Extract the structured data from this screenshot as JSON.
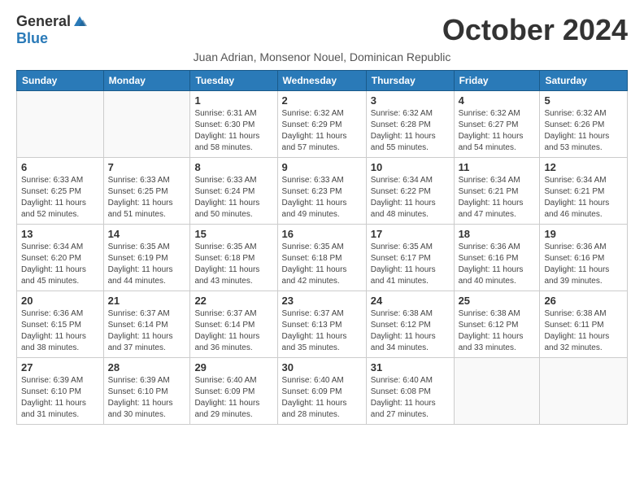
{
  "logo": {
    "general": "General",
    "blue": "Blue"
  },
  "title": "October 2024",
  "subtitle": "Juan Adrian, Monsenor Nouel, Dominican Republic",
  "headers": [
    "Sunday",
    "Monday",
    "Tuesday",
    "Wednesday",
    "Thursday",
    "Friday",
    "Saturday"
  ],
  "weeks": [
    [
      {
        "day": "",
        "info": ""
      },
      {
        "day": "",
        "info": ""
      },
      {
        "day": "1",
        "info": "Sunrise: 6:31 AM\nSunset: 6:30 PM\nDaylight: 11 hours and 58 minutes."
      },
      {
        "day": "2",
        "info": "Sunrise: 6:32 AM\nSunset: 6:29 PM\nDaylight: 11 hours and 57 minutes."
      },
      {
        "day": "3",
        "info": "Sunrise: 6:32 AM\nSunset: 6:28 PM\nDaylight: 11 hours and 55 minutes."
      },
      {
        "day": "4",
        "info": "Sunrise: 6:32 AM\nSunset: 6:27 PM\nDaylight: 11 hours and 54 minutes."
      },
      {
        "day": "5",
        "info": "Sunrise: 6:32 AM\nSunset: 6:26 PM\nDaylight: 11 hours and 53 minutes."
      }
    ],
    [
      {
        "day": "6",
        "info": "Sunrise: 6:33 AM\nSunset: 6:25 PM\nDaylight: 11 hours and 52 minutes."
      },
      {
        "day": "7",
        "info": "Sunrise: 6:33 AM\nSunset: 6:25 PM\nDaylight: 11 hours and 51 minutes."
      },
      {
        "day": "8",
        "info": "Sunrise: 6:33 AM\nSunset: 6:24 PM\nDaylight: 11 hours and 50 minutes."
      },
      {
        "day": "9",
        "info": "Sunrise: 6:33 AM\nSunset: 6:23 PM\nDaylight: 11 hours and 49 minutes."
      },
      {
        "day": "10",
        "info": "Sunrise: 6:34 AM\nSunset: 6:22 PM\nDaylight: 11 hours and 48 minutes."
      },
      {
        "day": "11",
        "info": "Sunrise: 6:34 AM\nSunset: 6:21 PM\nDaylight: 11 hours and 47 minutes."
      },
      {
        "day": "12",
        "info": "Sunrise: 6:34 AM\nSunset: 6:21 PM\nDaylight: 11 hours and 46 minutes."
      }
    ],
    [
      {
        "day": "13",
        "info": "Sunrise: 6:34 AM\nSunset: 6:20 PM\nDaylight: 11 hours and 45 minutes."
      },
      {
        "day": "14",
        "info": "Sunrise: 6:35 AM\nSunset: 6:19 PM\nDaylight: 11 hours and 44 minutes."
      },
      {
        "day": "15",
        "info": "Sunrise: 6:35 AM\nSunset: 6:18 PM\nDaylight: 11 hours and 43 minutes."
      },
      {
        "day": "16",
        "info": "Sunrise: 6:35 AM\nSunset: 6:18 PM\nDaylight: 11 hours and 42 minutes."
      },
      {
        "day": "17",
        "info": "Sunrise: 6:35 AM\nSunset: 6:17 PM\nDaylight: 11 hours and 41 minutes."
      },
      {
        "day": "18",
        "info": "Sunrise: 6:36 AM\nSunset: 6:16 PM\nDaylight: 11 hours and 40 minutes."
      },
      {
        "day": "19",
        "info": "Sunrise: 6:36 AM\nSunset: 6:16 PM\nDaylight: 11 hours and 39 minutes."
      }
    ],
    [
      {
        "day": "20",
        "info": "Sunrise: 6:36 AM\nSunset: 6:15 PM\nDaylight: 11 hours and 38 minutes."
      },
      {
        "day": "21",
        "info": "Sunrise: 6:37 AM\nSunset: 6:14 PM\nDaylight: 11 hours and 37 minutes."
      },
      {
        "day": "22",
        "info": "Sunrise: 6:37 AM\nSunset: 6:14 PM\nDaylight: 11 hours and 36 minutes."
      },
      {
        "day": "23",
        "info": "Sunrise: 6:37 AM\nSunset: 6:13 PM\nDaylight: 11 hours and 35 minutes."
      },
      {
        "day": "24",
        "info": "Sunrise: 6:38 AM\nSunset: 6:12 PM\nDaylight: 11 hours and 34 minutes."
      },
      {
        "day": "25",
        "info": "Sunrise: 6:38 AM\nSunset: 6:12 PM\nDaylight: 11 hours and 33 minutes."
      },
      {
        "day": "26",
        "info": "Sunrise: 6:38 AM\nSunset: 6:11 PM\nDaylight: 11 hours and 32 minutes."
      }
    ],
    [
      {
        "day": "27",
        "info": "Sunrise: 6:39 AM\nSunset: 6:10 PM\nDaylight: 11 hours and 31 minutes."
      },
      {
        "day": "28",
        "info": "Sunrise: 6:39 AM\nSunset: 6:10 PM\nDaylight: 11 hours and 30 minutes."
      },
      {
        "day": "29",
        "info": "Sunrise: 6:40 AM\nSunset: 6:09 PM\nDaylight: 11 hours and 29 minutes."
      },
      {
        "day": "30",
        "info": "Sunrise: 6:40 AM\nSunset: 6:09 PM\nDaylight: 11 hours and 28 minutes."
      },
      {
        "day": "31",
        "info": "Sunrise: 6:40 AM\nSunset: 6:08 PM\nDaylight: 11 hours and 27 minutes."
      },
      {
        "day": "",
        "info": ""
      },
      {
        "day": "",
        "info": ""
      }
    ]
  ]
}
